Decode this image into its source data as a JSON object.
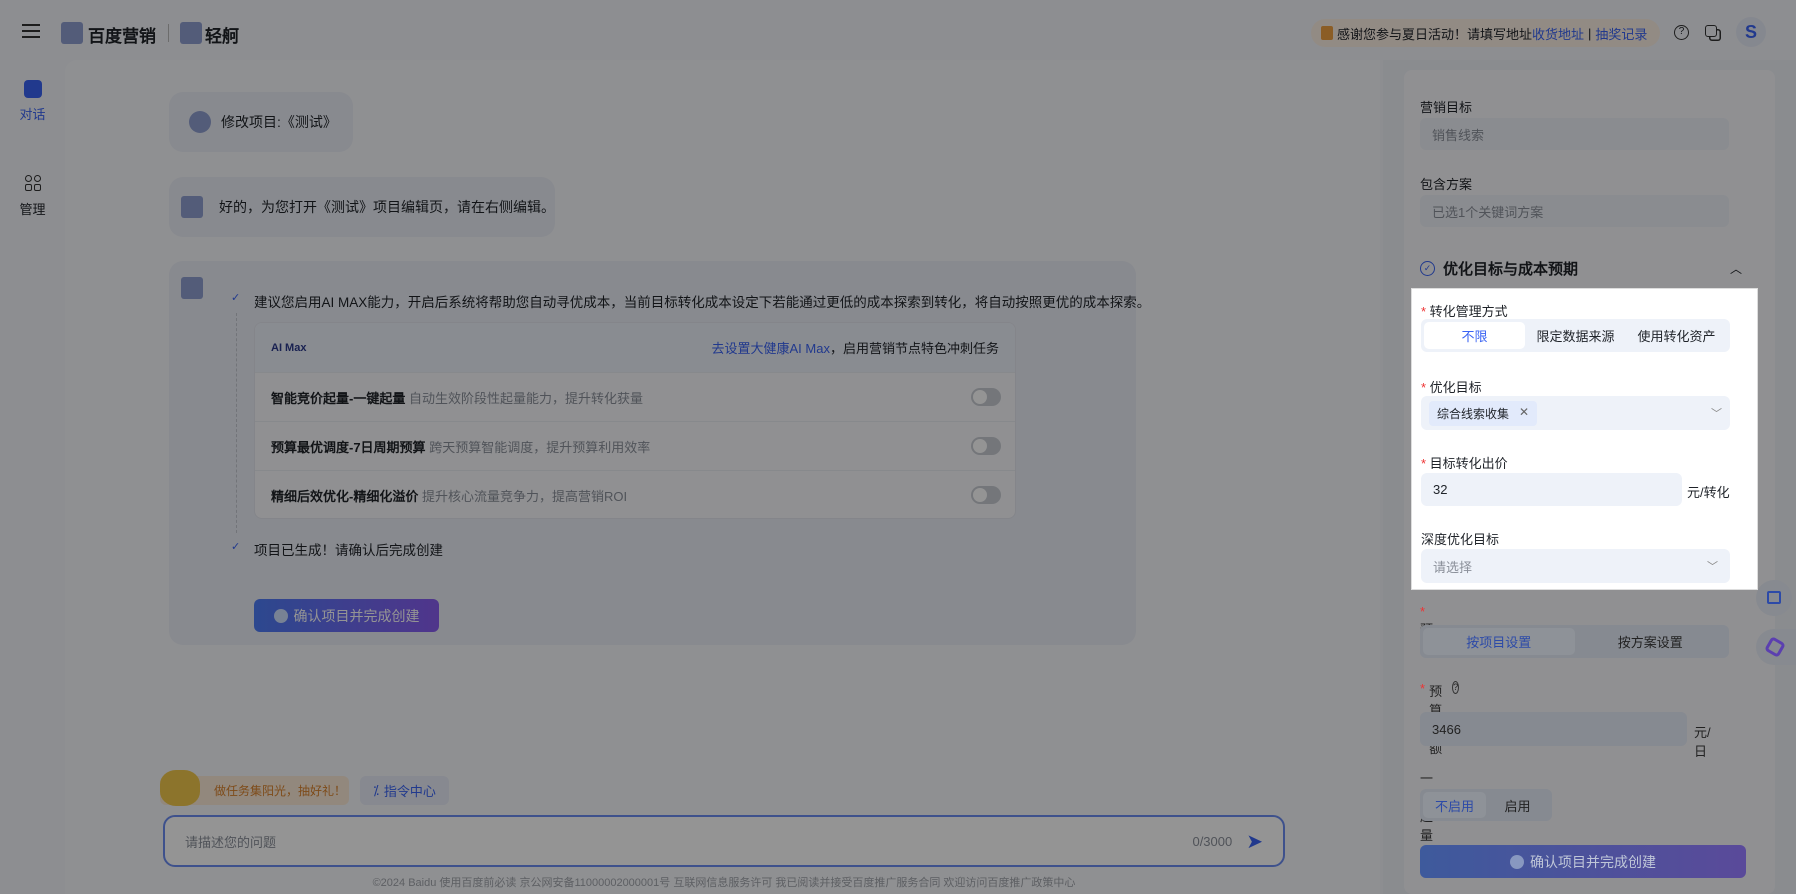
{
  "header": {
    "brand": "百度营销",
    "product": "轻舸",
    "notice": "感谢您参与夏日活动！请填写地址",
    "notice_link1": "收货地址",
    "notice_sep": "|",
    "notice_link2": "抽奖记录",
    "user_initial": "S"
  },
  "sidebar": {
    "items": [
      {
        "label": "对话",
        "active": true
      },
      {
        "label": "管理",
        "active": false
      }
    ]
  },
  "chat": {
    "msg1": "修改项目:《测试》",
    "msg2": "好的，为您打开《测试》项目编辑页，请在右侧编辑。",
    "suggestion": "建议您启用AI MAX能力，开启后系统将帮助您自动寻优成本，当前目标转化成本设定下若能通过更低的成本探索到转化，将自动按照更优的成本探索。",
    "aimax": {
      "logo": "AI Max",
      "link": "去设置大健康AI Max",
      "link_suffix": "，启用营销节点特色冲刺任务",
      "rows": [
        {
          "title": "智能竞价起量-一键起量",
          "desc": "自动生效阶段性起量能力，提升转化获量",
          "enabled": false
        },
        {
          "title": "预算最优调度-7日周期预算",
          "desc": "跨天预算智能调度，提升预算利用效率",
          "enabled": false
        },
        {
          "title": "精细后效优化-精细化溢价",
          "desc": "提升核心流量竞争力，提高营销ROI",
          "enabled": false
        }
      ]
    },
    "generated": "项目已生成！请确认后完成创建",
    "confirm_button": "确认项目并完成创建"
  },
  "composer": {
    "task_tag": "做任务集阳光，抽好礼！",
    "command_center": "指令中心",
    "placeholder": "请描述您的问题",
    "counter": "0/3000"
  },
  "footer": "©2024 Baidu 使用百度前必读 京公网安备11000002000001号 互联网信息服务许可 我已阅读并接受百度推广服务合同 欢迎访问百度推广政策中心",
  "form": {
    "marketing_goal_label": "营销目标",
    "marketing_goal_value": "销售线索",
    "plan_label": "包含方案",
    "plan_value": "已选1个关键词方案",
    "section_title": "优化目标与成本预期",
    "conv_mgmt_label": "转化管理方式",
    "conv_mgmt_options": [
      "不限",
      "限定数据来源",
      "使用转化资产"
    ],
    "conv_mgmt_selected": "不限",
    "opt_goal_label": "优化目标",
    "opt_goal_tag": "综合线索收集",
    "bid_label": "目标转化出价",
    "bid_value": "32",
    "bid_unit": "元/转化",
    "deep_goal_label": "深度优化目标",
    "deep_goal_placeholder": "请选择",
    "budget_label": "预算",
    "budget_options": [
      "按项目设置",
      "按方案设置"
    ],
    "budget_selected": "按项目设置",
    "budget_amount_label": "预算金额",
    "budget_amount_value": "3466",
    "budget_unit": "元/日",
    "boost_label": "一键起量",
    "boost_options": [
      "不启用",
      "启用"
    ],
    "boost_selected": "不启用",
    "submit": "确认项目并完成创建"
  },
  "colors": {
    "accent": "#3a63f3",
    "required": "#e33333",
    "overlay": "rgba(0,0,0,0.42)"
  }
}
